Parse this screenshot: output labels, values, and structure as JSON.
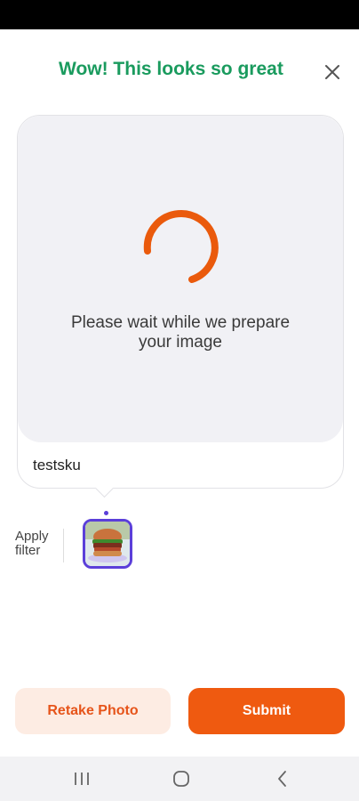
{
  "header": {
    "title": "Wow! This looks so great",
    "title_color": "#1a9b5e",
    "close_icon": "close-icon"
  },
  "preview": {
    "loading_message": "Please wait while we prepare your image",
    "sku": "testsku",
    "spinner_color": "#ea5a0c"
  },
  "filters": {
    "label": "Apply filter",
    "items": [
      {
        "icon": "burger-thumbnail",
        "selected": true
      }
    ],
    "selected_color": "#5b3fd9"
  },
  "actions": {
    "retake_label": "Retake Photo",
    "submit_label": "Submit",
    "accent_color": "#ef5a10"
  },
  "system_nav": {
    "recents_icon": "recents-icon",
    "home_icon": "home-icon",
    "back_icon": "back-icon"
  }
}
